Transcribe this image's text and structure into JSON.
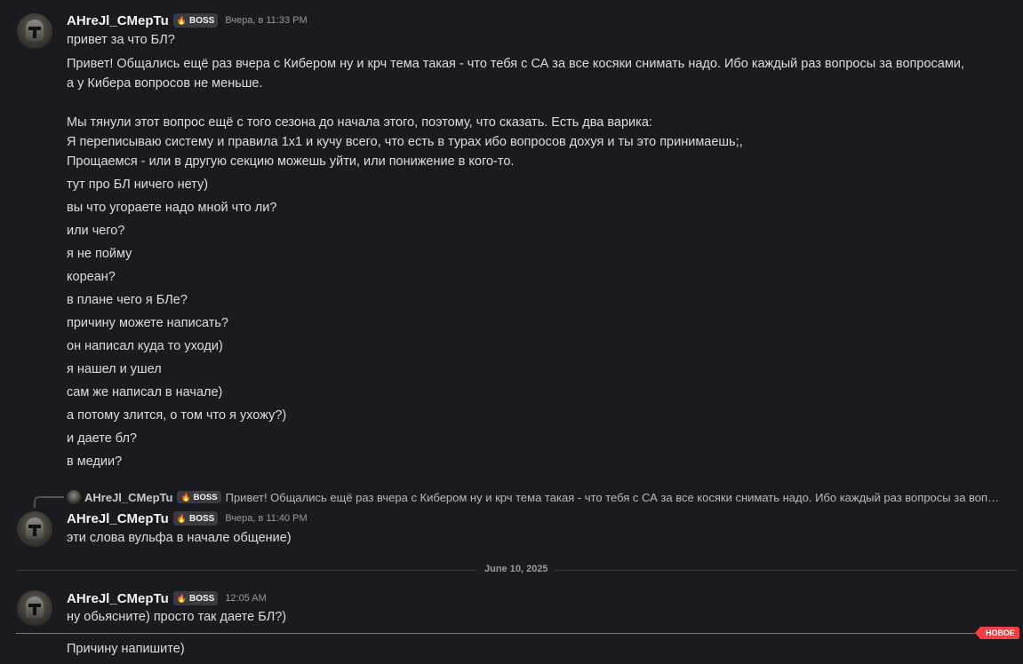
{
  "user": {
    "name": "AHreJl_CMepTu",
    "tag": "BOSS",
    "tag_icon": "🔥"
  },
  "messages": [
    {
      "time": "Вчера, в 11:33 PM",
      "lines": [
        "привет за что БЛ?",
        "Привет! Общались ещё раз вчера с Кибером ну и крч тема такая - что тебя с СА за все косяки снимать надо. Ибо каждый раз вопросы за вопросами,",
        "а у Кибера вопросов не меньше.",
        "",
        "Мы тянули этот вопрос ещё с того сезона до начала этого, поэтому, что сказать. Есть два варика:",
        "Я переписываю систему и правила 1х1 и кучу всего, что есть в турах ибо вопросов дохуя и ты это принимаешь;,",
        "Прощаемся - или в другую секцию можешь уйти, или понижение в кого-то.",
        "тут про БЛ ничего нету)",
        "вы что угораете надо мной что ли?",
        "или чего?",
        "я не пойму",
        "кореан?",
        "в плане чего я БЛе?",
        "причину можете написать?",
        "он написал куда то уходи)",
        "я нашел и ушел",
        "сам же написал в начале)",
        "а потому злится, о том что я ухожу?)",
        "и даете бл?",
        "в медии?"
      ]
    },
    {
      "reply_preview": "Привет! Общались ещё раз вчера с Кибером ну и крч тема такая - что тебя с СА за все косяки снимать надо. Ибо каждый раз вопросы за воп…",
      "time": "Вчера, в 11:40 PM",
      "lines": [
        "эти слова вульфа в начале общение)"
      ]
    },
    {
      "time": "12:05 AM",
      "lines": [
        "ну обьясните) просто так даете БЛ?)",
        "Причину напишите)"
      ]
    }
  ],
  "date_divider": "June 10, 2025",
  "new_badge": "НОВОЕ",
  "colors": {
    "background": "#1b1b1f",
    "text": "#dbdee1",
    "muted": "#949ba4",
    "new": "#f23f43"
  }
}
